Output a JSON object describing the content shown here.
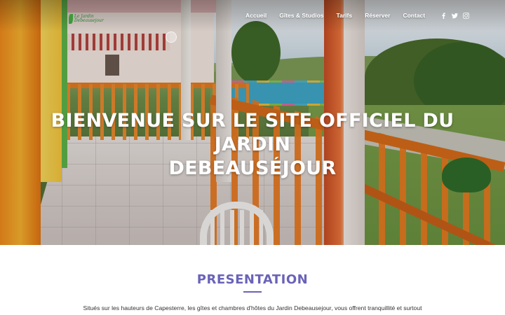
{
  "site": {
    "logo_text": "Le Jardin Debeausejour",
    "logo_leaf_color": "#3d9a3a"
  },
  "nav": {
    "items": [
      {
        "label": "Accueil"
      },
      {
        "label": "Gîtes & Studios"
      },
      {
        "label": "Tarifs"
      },
      {
        "label": "Réserver"
      },
      {
        "label": "Contact"
      }
    ],
    "social": [
      {
        "icon": "facebook-icon"
      },
      {
        "icon": "twitter-icon"
      },
      {
        "icon": "instagram-icon"
      }
    ]
  },
  "hero": {
    "title_line1": "BIENVENUE SUR LE SITE OFFICIEL DU JARDIN",
    "title_line2": "DEBEAUSÉJOUR"
  },
  "presentation": {
    "title": "PRESENTATION",
    "text": "Situés sur les hauteurs de Capesterre, les gîtes et chambres d'hôtes du Jardin Debeausejour, vous offrent tranquillité et surtout",
    "accent_color": "#6a63b8"
  }
}
